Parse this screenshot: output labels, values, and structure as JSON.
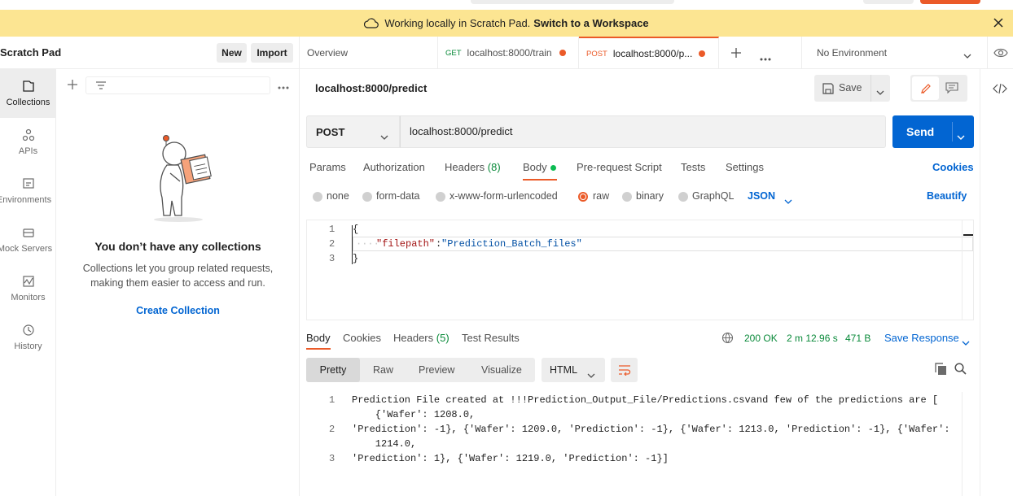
{
  "banner": {
    "text": "Working locally in Scratch Pad.",
    "link": "Switch to a Workspace"
  },
  "sidebar": {
    "title": "Scratch Pad",
    "new_label": "New",
    "import_label": "Import",
    "nav": [
      {
        "label": "Collections",
        "icon": "collections-icon"
      },
      {
        "label": "APIs",
        "icon": "apis-icon"
      },
      {
        "label": "Environments",
        "icon": "environments-icon"
      },
      {
        "label": "Mock Servers",
        "icon": "mock-servers-icon"
      },
      {
        "label": "Monitors",
        "icon": "monitors-icon"
      },
      {
        "label": "History",
        "icon": "history-icon"
      }
    ],
    "empty": {
      "title": "You don’t have any collections",
      "desc": "Collections let you group related requests, making them easier to access and run.",
      "link": "Create Collection"
    }
  },
  "tabs": [
    {
      "label": "Overview"
    },
    {
      "method": "GET",
      "label": "localhost:8000/train"
    },
    {
      "method": "POST",
      "label": "localhost:8000/p..."
    }
  ],
  "environment": "No Environment",
  "request": {
    "title": "localhost:8000/predict",
    "save_label": "Save",
    "method": "POST",
    "url": "localhost:8000/predict",
    "send_label": "Send",
    "tabs": [
      "Params",
      "Authorization",
      "Headers",
      "Body",
      "Pre-request Script",
      "Tests",
      "Settings"
    ],
    "headers_count": "(8)",
    "cookies_label": "Cookies",
    "body_types": [
      "none",
      "form-data",
      "x-www-form-urlencoded",
      "raw",
      "binary",
      "GraphQL"
    ],
    "raw_format": "JSON",
    "beautify_label": "Beautify",
    "body_lines": [
      "1",
      "2",
      "3"
    ],
    "body_line1": "{",
    "body_key": "\"filepath\"",
    "body_colon": ":",
    "body_value": "\"Prediction_Batch_files\"",
    "body_line3": "}"
  },
  "response": {
    "tabs": [
      "Body",
      "Cookies",
      "Headers",
      "Test Results"
    ],
    "headers_count": "(5)",
    "status": "200 OK",
    "time": "2 m 12.96 s",
    "size": "471 B",
    "save_label": "Save Response",
    "views": [
      "Pretty",
      "Raw",
      "Preview",
      "Visualize"
    ],
    "format": "HTML",
    "line_numbers": [
      "1",
      "2",
      "3"
    ],
    "lines": [
      "Prediction File created at !!!Prediction_Output_File/Predictions.csvand few of the predictions are [",
      "    {'Wafer': 1208.0,",
      "'Prediction': -1}, {'Wafer': 1209.0, 'Prediction': -1}, {'Wafer': 1213.0, 'Prediction': -1}, {'Wafer':",
      "    1214.0,",
      "'Prediction': 1}, {'Wafer': 1219.0, 'Prediction': -1}]"
    ]
  },
  "colors": {
    "accent": "#eb5a28",
    "primary": "#0265d2",
    "banner": "#fce592",
    "success": "#0a8a3a"
  }
}
